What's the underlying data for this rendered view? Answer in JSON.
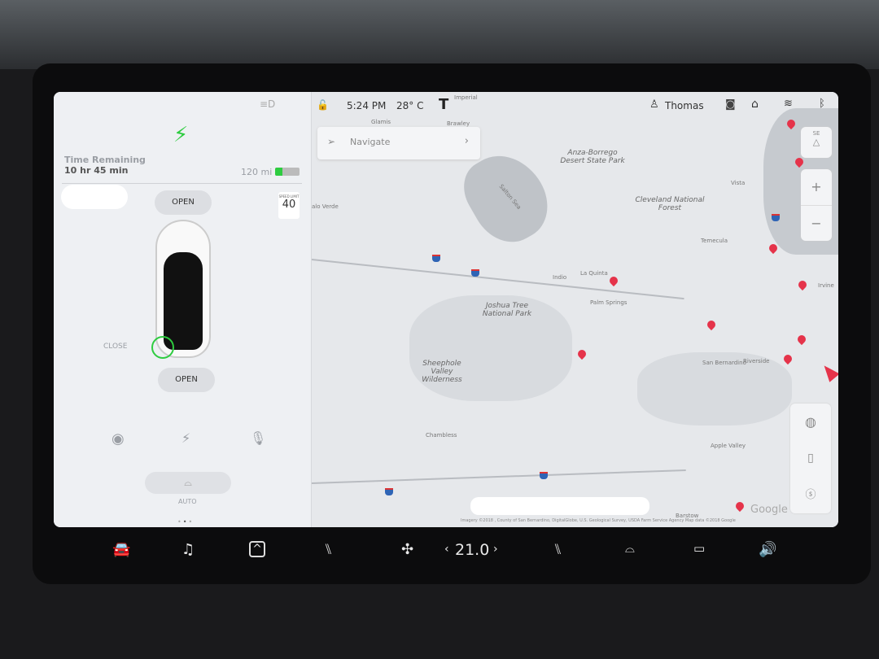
{
  "status_bar": {
    "time": "5:24 PM",
    "temperature": "28° C",
    "user": "Thomas"
  },
  "left_panel": {
    "charge_label": "Time Remaining",
    "charge_value": "10 hr 45 min",
    "range": "120 mi",
    "battery_level_pct": 30,
    "frunk_button": "OPEN",
    "trunk_button": "OPEN",
    "charge_port": "CLOSE",
    "speed_limit_label": "SPEED LIMIT",
    "speed_limit_value": "40",
    "wiper_label": "AUTO"
  },
  "map": {
    "navigate_placeholder": "Navigate",
    "compass": "SE",
    "labels": [
      "Imperial",
      "Glamis",
      "Brawley",
      "Anza-Borrego Desert State Park",
      "Salton Sea",
      "Cleveland National Forest",
      "Vista",
      "Temecula",
      "La Quinta",
      "Indio",
      "Palm Springs",
      "Joshua Tree National Park",
      "Sheephole Valley Wilderness",
      "Riverside",
      "San Bernardino",
      "Irvine",
      "Chambless",
      "Apple Valley",
      "Barstow",
      "alo Verde"
    ],
    "attribution": "Imagery ©2018 , County of San Bernardino, DigitalGlobe, U.S. Geological Survey, USDA Farm Service Agency Map data ©2018 Google",
    "google": "Google"
  },
  "climate": {
    "temperature": "21.0"
  },
  "accent_color": "#2ecc40",
  "pin_color": "#e5334a"
}
